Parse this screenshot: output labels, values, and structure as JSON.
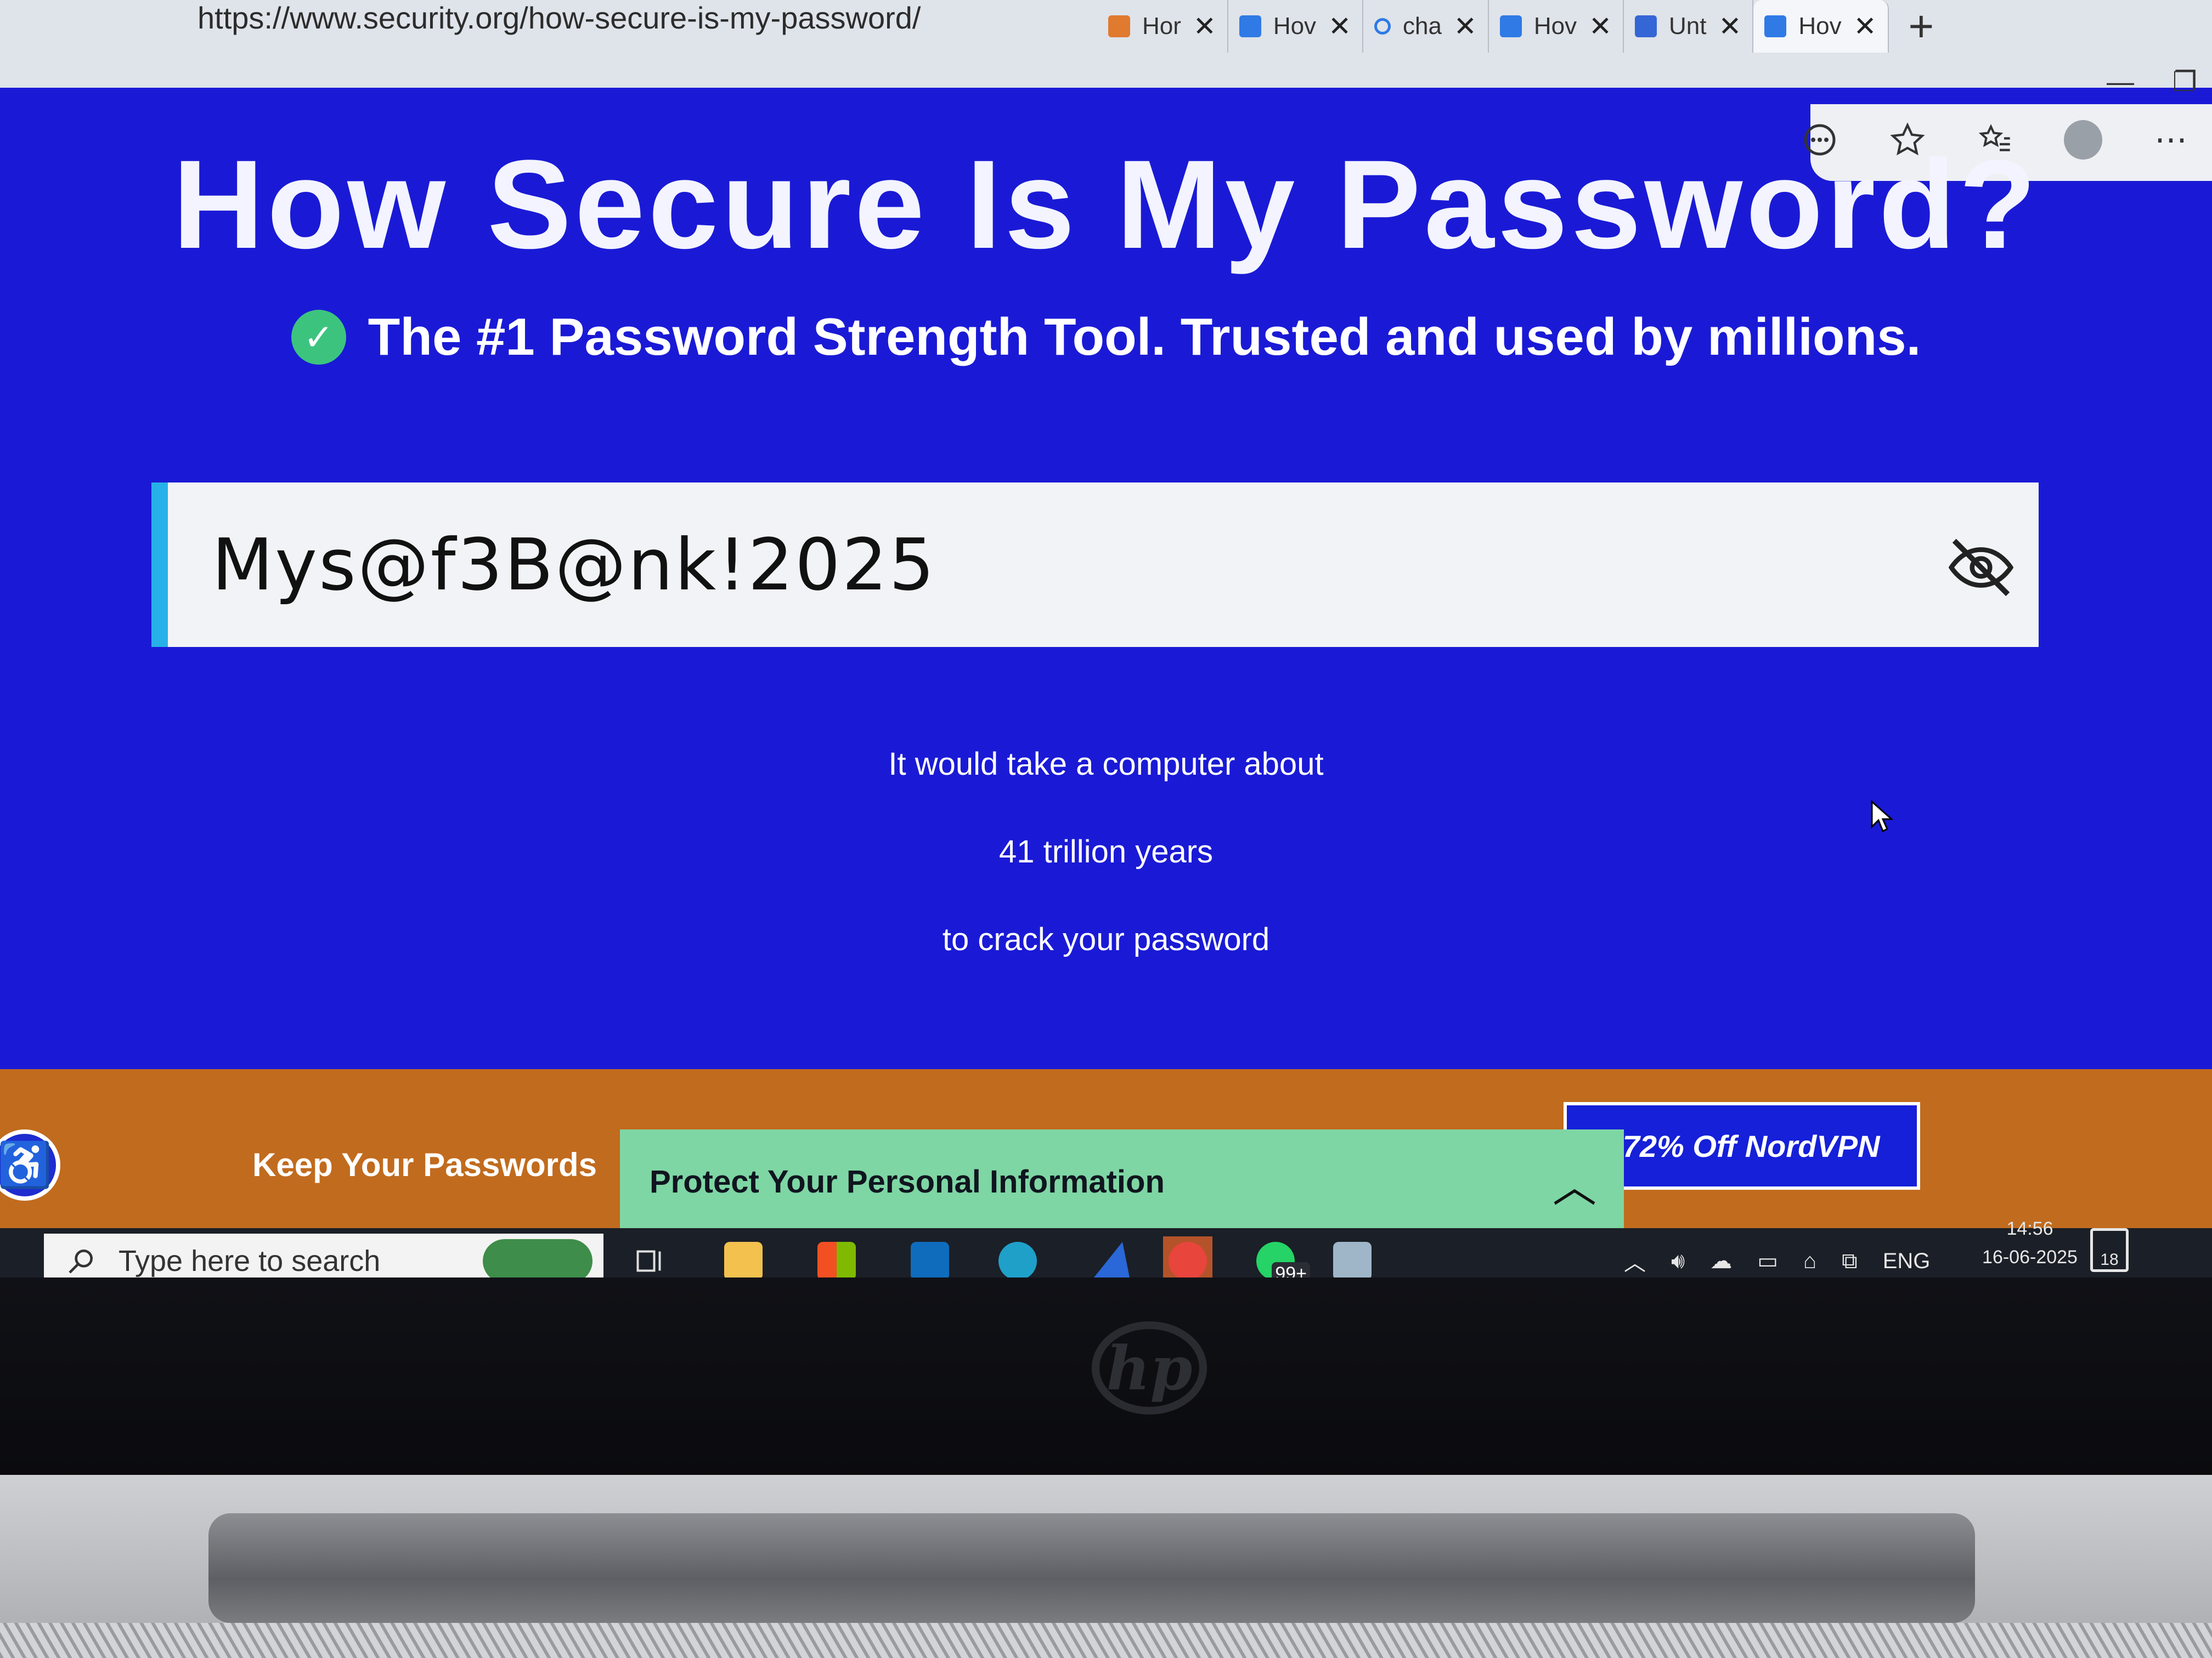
{
  "browser": {
    "url": "https://www.security.org/how-secure-is-my-password/",
    "tabs": [
      {
        "label": "Hor",
        "icon": "tab-favicon",
        "active": false
      },
      {
        "label": "Hov",
        "icon": "security-org-favicon",
        "active": false
      },
      {
        "label": "cha",
        "icon": "search-icon",
        "active": false
      },
      {
        "label": "Hov",
        "icon": "security-org-favicon",
        "active": false
      },
      {
        "label": "Unt",
        "icon": "doc-icon",
        "active": false
      },
      {
        "label": "Hov",
        "icon": "security-org-favicon",
        "active": true
      }
    ],
    "new_tab_label": "+",
    "close_glyph": "✕"
  },
  "page": {
    "title": "How Secure Is My Password?",
    "subtitle": "The #1 Password Strength Tool. Trusted and used by millions.",
    "password_value": "Mys@f3B@nk!2025",
    "result_line1": "It would take a computer about",
    "result_line2": "41 trillion years",
    "result_line3": "to crack your password"
  },
  "banner": {
    "keep_text": "Keep Your Passwords",
    "nordvpn_text": "t 72% Off NordVPN",
    "protect_title": "Protect Your Personal Information"
  },
  "taskbar": {
    "search_placeholder": "Type here to search",
    "whatsapp_badge": "99+",
    "language": "ENG",
    "time": "14:56",
    "date": "16-06-2025",
    "notifications": "18"
  },
  "colors": {
    "page_bg": "#1a1ad6",
    "accent_green": "#3cc47f",
    "input_accent": "#27b1e8",
    "banner_orange": "#c16b1e",
    "protect_panel": "#7ed6a4"
  }
}
